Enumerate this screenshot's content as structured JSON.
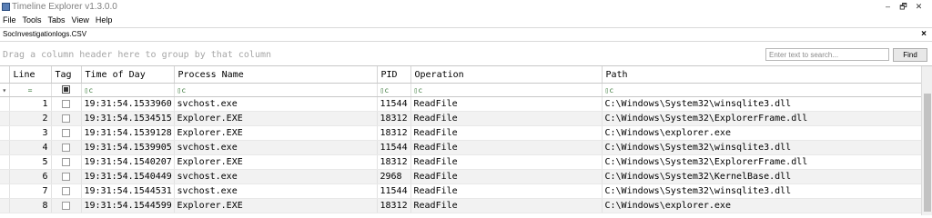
{
  "window": {
    "title": "Timeline Explorer v1.3.0.0",
    "minimize_glyph": "‒",
    "restore_glyph": "🗗",
    "close_glyph": "✕"
  },
  "menu": [
    "File",
    "Tools",
    "Tabs",
    "View",
    "Help"
  ],
  "tab": {
    "label": "SocInvestigationlogs.CSV",
    "close_glyph": "×"
  },
  "group_panel": {
    "hint": "Drag a column header here to group by that column"
  },
  "search": {
    "placeholder": "Enter text to search...",
    "find_label": "Find"
  },
  "grid": {
    "columns": [
      "Line",
      "Tag",
      "Time of Day",
      "Process Name",
      "PID",
      "Operation",
      "Path"
    ],
    "filter_glyphs": {
      "indicator": "▾",
      "line": "=",
      "text": "▯c"
    },
    "rows": [
      {
        "line": "1",
        "time": "19:31:54.1533960",
        "process": "svchost.exe",
        "pid": "11544",
        "operation": "ReadFile",
        "path": "C:\\Windows\\System32\\winsqlite3.dll"
      },
      {
        "line": "2",
        "time": "19:31:54.1534515",
        "process": "Explorer.EXE",
        "pid": "18312",
        "operation": "ReadFile",
        "path": "C:\\Windows\\System32\\ExplorerFrame.dll"
      },
      {
        "line": "3",
        "time": "19:31:54.1539128",
        "process": "Explorer.EXE",
        "pid": "18312",
        "operation": "ReadFile",
        "path": "C:\\Windows\\explorer.exe"
      },
      {
        "line": "4",
        "time": "19:31:54.1539905",
        "process": "svchost.exe",
        "pid": "11544",
        "operation": "ReadFile",
        "path": "C:\\Windows\\System32\\winsqlite3.dll"
      },
      {
        "line": "5",
        "time": "19:31:54.1540207",
        "process": "Explorer.EXE",
        "pid": "18312",
        "operation": "ReadFile",
        "path": "C:\\Windows\\System32\\ExplorerFrame.dll"
      },
      {
        "line": "6",
        "time": "19:31:54.1540449",
        "process": "svchost.exe",
        "pid": "2968",
        "operation": "ReadFile",
        "path": "C:\\Windows\\System32\\KernelBase.dll"
      },
      {
        "line": "7",
        "time": "19:31:54.1544531",
        "process": "svchost.exe",
        "pid": "11544",
        "operation": "ReadFile",
        "path": "C:\\Windows\\System32\\winsqlite3.dll"
      },
      {
        "line": "8",
        "time": "19:31:54.1544599",
        "process": "Explorer.EXE",
        "pid": "18312",
        "operation": "ReadFile",
        "path": "C:\\Windows\\explorer.exe"
      }
    ]
  },
  "colors": {
    "alt_row": "#f2f2f2",
    "filter_icon": "#3d7a3d",
    "grid_line": "#e2e2e2"
  }
}
